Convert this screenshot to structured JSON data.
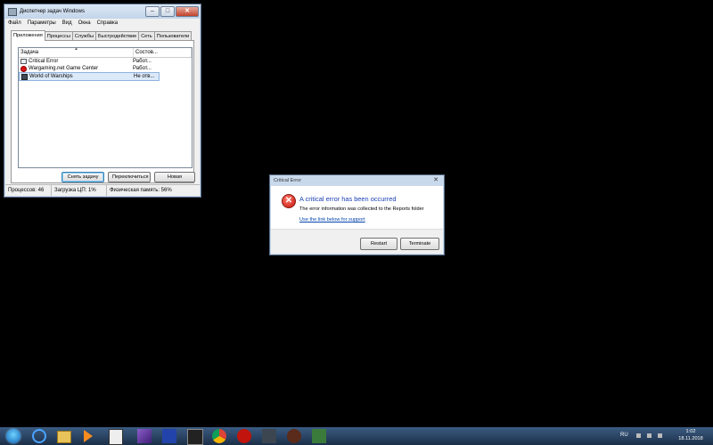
{
  "task_manager": {
    "title": "Диспетчер задач Windows",
    "menu": [
      "Файл",
      "Параметры",
      "Вид",
      "Окна",
      "Справка"
    ],
    "tabs": [
      "Приложения",
      "Процессы",
      "Службы",
      "Быстродействие",
      "Сеть",
      "Пользователи"
    ],
    "columns": {
      "task": "Задача",
      "status": "Состов..."
    },
    "rows": [
      {
        "name": "Critical Error",
        "status": "Работ...",
        "icon": "window-icon"
      },
      {
        "name": "Wargaming.net Game Center",
        "status": "Работ...",
        "icon": "wargaming-icon"
      },
      {
        "name": "World of Warships",
        "status": "Не отв...",
        "icon": "warships-icon"
      }
    ],
    "buttons": {
      "end_task": "Снять задачу",
      "switch_to": "Переключиться",
      "new_task": "Новая задача..."
    },
    "status": {
      "processes": "Процессов: 46",
      "cpu": "Загрузка ЦП: 1%",
      "memory": "Физическая память: 56%"
    }
  },
  "critical_error": {
    "title": "Critical Error",
    "heading": "A critical error has been occurred",
    "message": "The error information was collected to the Reports folder",
    "link": "Use the link below for support",
    "buttons": {
      "restart": "Restart",
      "terminate": "Terminate"
    },
    "accent": "#1a3fb5"
  },
  "taskbar": {
    "language": "RU",
    "time": "1:02",
    "date": "18.11.2018",
    "pinned": [
      "ie-icon",
      "explorer-icon",
      "media-player-icon",
      "calendar-icon",
      "visual-studio-icon",
      "text-editor-icon",
      "media-icon",
      "chrome-icon",
      "wargaming-icon",
      "world-of-warships-icon",
      "world-of-tanks-icon",
      "game-center-icon"
    ]
  }
}
